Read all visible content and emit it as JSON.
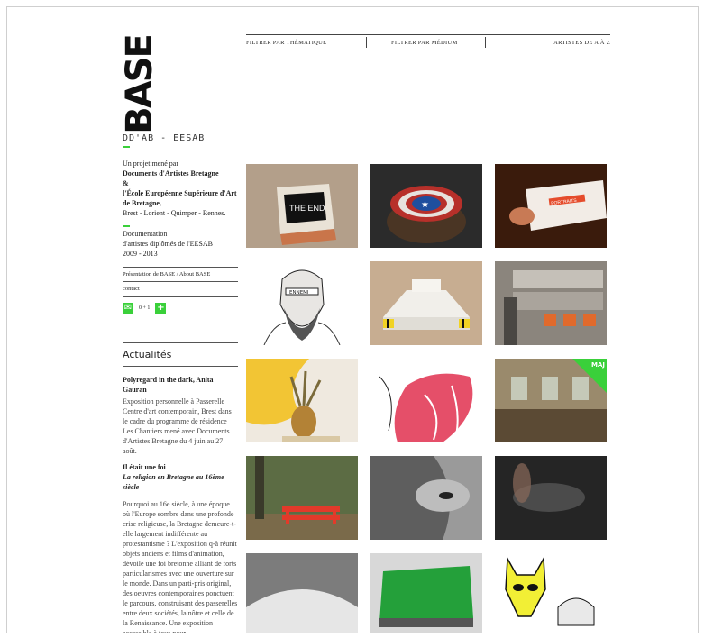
{
  "logo": {
    "text": "BASE",
    "subtitle": "DD'AB - EESAB"
  },
  "intro": {
    "line1": "Un projet mené par",
    "org1": "Documents d'Artistes Bretagne",
    "amp": "&",
    "org2": "l'École Européenne Supérieure d'Art de Bretagne,",
    "cities": "Brest - Lorient - Quimper - Rennes."
  },
  "doc": {
    "line1": "Documentation",
    "line2": "d'artistes diplômés de l'EESAB",
    "years": "2009 - 2013"
  },
  "links": {
    "presentation": "Présentation de BASE / About BASE",
    "contact": "contact"
  },
  "social": {
    "counter": "0 + 1"
  },
  "news": {
    "heading": "Actualités",
    "items": [
      {
        "title": "Polyregard in the dark, Anita Gauran",
        "body": "Exposition personnelle à Passerelle Centre d'art contemporain, Brest dans le cadre du programme de résidence Les Chantiers mené avec Documents d'Artistes Bretagne du 4 juin au 27 août."
      },
      {
        "title": "Il était une foi",
        "subtitle": "La religion en Bretagne au 16ème siècle",
        "body": "Pourquoi au 16e siècle, à une époque où l'Europe sombre dans une profonde crise religieuse, la Bretagne demeure-t-elle largement indifférente au protestantisme ? L'exposition q-à réunit objets anciens et films d'animation, dévoile une foi bretonne alliant de forts particularismes avec une ouverture sur le monde. Dans un parti-pris original, des oeuvres contemporaines ponctuent le parcours, construisant des passerelles entre deux sociétés, la nôtre et celle de la Renaissance. Une exposition accessible à tous pour"
      }
    ]
  },
  "filters": {
    "thematique": "FILTRER PAR THÉMATIQUE",
    "medium": "FILTRER PAR MÉDIUM",
    "artists": "ARTISTES DE A À Z"
  },
  "badge": {
    "maj": "MAJ"
  },
  "tile_titles": [
    "the-end-box",
    "captain-shield-stump",
    "business-card",
    "bearded-man-drawing",
    "white-model",
    "shelf-installation",
    "pineapple-sculpture",
    "pink-drawing",
    "abandoned-room",
    "red-bench",
    "face-closeup",
    "dark-texture",
    "grey-curve",
    "green-sculpture",
    "cat-mask-drawing"
  ],
  "the_end_text": "THE END",
  "card_text": "PORTRAITS",
  "headband_text": "ENNEMI"
}
